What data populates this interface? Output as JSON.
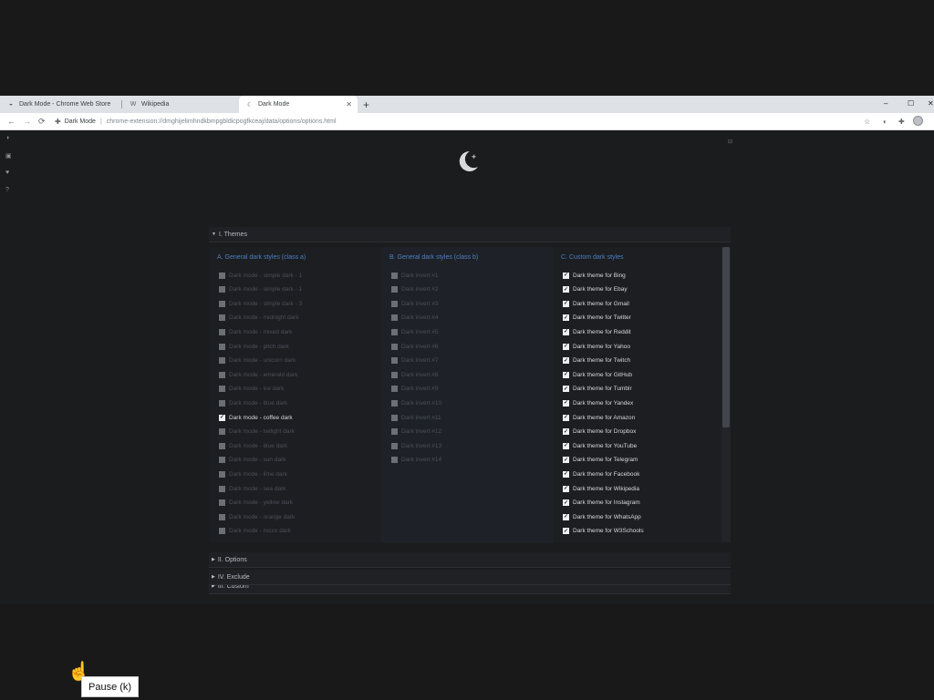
{
  "browser": {
    "tabs": [
      {
        "title": "Dark Mode - Chrome Web Store",
        "favicon": "chrome-web-store-icon"
      },
      {
        "title": "Wikipedia",
        "favicon": "wikipedia-icon",
        "favicon_text": "W"
      },
      {
        "title": "Dark Mode",
        "favicon": "dark-mode-icon"
      }
    ],
    "new_tab_label": "+",
    "tab_close_glyph": "✕",
    "window_controls": {
      "minimize": "–",
      "maximize": "☐",
      "close": "✕"
    },
    "toolbar": {
      "back": "←",
      "forward": "→",
      "reload": "⟳",
      "site_name": "Dark Mode",
      "url": "chrome-extension://dmghijelimhndkbmpgbldicpogfkceaj/data/options/options.html"
    }
  },
  "page": {
    "sections": [
      {
        "label": "I. Themes",
        "arrow": "▼"
      },
      {
        "label": "II. Options",
        "arrow": "▶"
      },
      {
        "label": "III. Custom",
        "arrow": "▶"
      },
      {
        "label": "IV. Exclude",
        "arrow": "▶"
      }
    ],
    "themes": {
      "columns": [
        {
          "header": "A. General dark styles (class a)",
          "items": [
            {
              "label": "Dark mode - simple dark - 1",
              "checked": false
            },
            {
              "label": "Dark mode - simple dark - 1",
              "checked": false
            },
            {
              "label": "Dark mode - simple dark - 3",
              "checked": false
            },
            {
              "label": "Dark mode - midnight dark",
              "checked": false
            },
            {
              "label": "Dark mode - mixed dark",
              "checked": false
            },
            {
              "label": "Dark mode - pitch dark",
              "checked": false
            },
            {
              "label": "Dark mode - unicorn dark",
              "checked": false
            },
            {
              "label": "Dark mode - emerald dark",
              "checked": false
            },
            {
              "label": "Dark mode - ice dark",
              "checked": false
            },
            {
              "label": "Dark mode - blue dark",
              "checked": false
            },
            {
              "label": "Dark mode - coffee dark",
              "checked": true
            },
            {
              "label": "Dark mode - twilight dark",
              "checked": false
            },
            {
              "label": "Dark mode - blue dark",
              "checked": false
            },
            {
              "label": "Dark mode - sun dark",
              "checked": false
            },
            {
              "label": "Dark mode - lime dark",
              "checked": false
            },
            {
              "label": "Dark mode - sea dark",
              "checked": false
            },
            {
              "label": "Dark mode - yellow dark",
              "checked": false
            },
            {
              "label": "Dark mode - orange dark",
              "checked": false
            },
            {
              "label": "Dark mode - rocco dark",
              "checked": false
            }
          ]
        },
        {
          "header": "B. General dark styles (class b)",
          "items": [
            {
              "label": "Dark invert #1",
              "checked": false
            },
            {
              "label": "Dark invert #2",
              "checked": false
            },
            {
              "label": "Dark invert #3",
              "checked": false
            },
            {
              "label": "Dark invert #4",
              "checked": false
            },
            {
              "label": "Dark invert #5",
              "checked": false
            },
            {
              "label": "Dark invert #6",
              "checked": false
            },
            {
              "label": "Dark invert #7",
              "checked": false
            },
            {
              "label": "Dark invert #8",
              "checked": false
            },
            {
              "label": "Dark invert #9",
              "checked": false
            },
            {
              "label": "Dark invert #10",
              "checked": false
            },
            {
              "label": "Dark invert #11",
              "checked": false
            },
            {
              "label": "Dark invert #12",
              "checked": false
            },
            {
              "label": "Dark invert #13",
              "checked": false
            },
            {
              "label": "Dark invert #14",
              "checked": false
            }
          ]
        },
        {
          "header": "C. Custom dark styles",
          "items": [
            {
              "label": "Dark theme for Bing",
              "checked": true
            },
            {
              "label": "Dark theme for Ebay",
              "checked": true
            },
            {
              "label": "Dark theme for Gmail",
              "checked": true
            },
            {
              "label": "Dark theme for Twitter",
              "checked": true
            },
            {
              "label": "Dark theme for Reddit",
              "checked": true
            },
            {
              "label": "Dark theme for Yahoo",
              "checked": true
            },
            {
              "label": "Dark theme for Twitch",
              "checked": true
            },
            {
              "label": "Dark theme for GitHub",
              "checked": true
            },
            {
              "label": "Dark theme for Tumblr",
              "checked": true
            },
            {
              "label": "Dark theme for Yandex",
              "checked": true
            },
            {
              "label": "Dark theme for Amazon",
              "checked": true
            },
            {
              "label": "Dark theme for Dropbox",
              "checked": true
            },
            {
              "label": "Dark theme for YouTube",
              "checked": true
            },
            {
              "label": "Dark theme for Telegram",
              "checked": true
            },
            {
              "label": "Dark theme for Facebook",
              "checked": true
            },
            {
              "label": "Dark theme for Wikipedia",
              "checked": true
            },
            {
              "label": "Dark theme for Instagram",
              "checked": true
            },
            {
              "label": "Dark theme for WhatsApp",
              "checked": true
            },
            {
              "label": "Dark theme for W3Schools",
              "checked": true
            }
          ]
        }
      ]
    },
    "check_glyph": "✓"
  },
  "tooltip": {
    "text": "Pause (k)"
  },
  "colors": {
    "accent": "#4e7fc0",
    "background": "#1b1c1e",
    "outer": "#191919"
  }
}
